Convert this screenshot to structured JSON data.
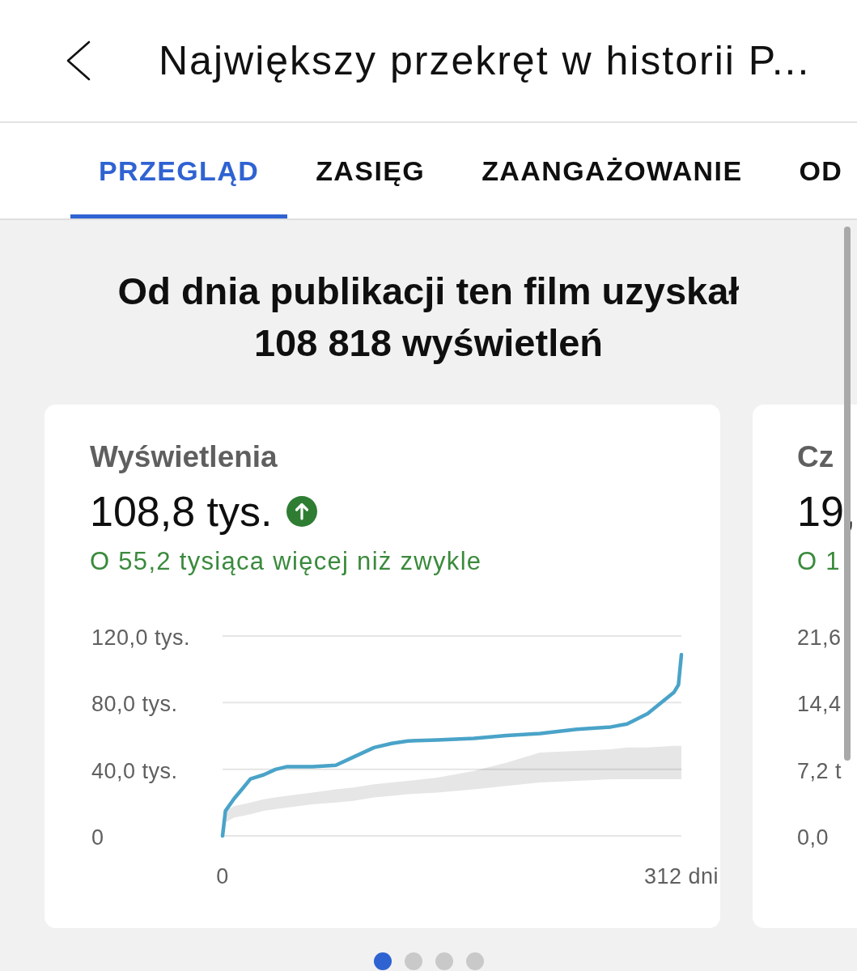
{
  "header": {
    "title": "Największy przekręt w historii P..."
  },
  "tabs": [
    {
      "label": "PRZEGLĄD",
      "selected": true
    },
    {
      "label": "ZASIĘG",
      "selected": false
    },
    {
      "label": "ZAANGAŻOWANIE",
      "selected": false
    },
    {
      "label": "OD",
      "selected": false
    }
  ],
  "headline": "Od dnia publikacji ten film uzyskał 108 818 wyświetleń",
  "cards": [
    {
      "title": "Wyświetlenia",
      "value": "108,8 tys.",
      "trend_up": true,
      "comparison": "O 55,2 tysiąca więcej niż zwykle",
      "typical_range": true,
      "chart_data": {
        "type": "line",
        "x": [
          0,
          2,
          8,
          14,
          19,
          28,
          36,
          44,
          61,
          77,
          89,
          103,
          115,
          126,
          146,
          171,
          193,
          216,
          241,
          264,
          275,
          289,
          307,
          310,
          312
        ],
        "series": [
          {
            "color": "#4aa3c8",
            "values": [
              0,
              15,
              22.5,
              28.8,
              34.2,
              36.7,
              39.9,
              41.6,
              41.6,
              42.4,
              47.3,
              53,
              55.5,
              57,
              57.5,
              58.5,
              60.2,
              61.5,
              64,
              65.4,
              67.2,
              73.4,
              86.3,
              90.7,
              108.8
            ]
          }
        ],
        "xlim": [
          0,
          312
        ],
        "ylim": [
          0,
          120
        ],
        "xticks": [
          {
            "value": 0,
            "label": "0"
          },
          {
            "value": 312,
            "label": "312 dni"
          }
        ],
        "yticks": [
          {
            "value": 120,
            "label": "120,0 tys."
          },
          {
            "value": 80,
            "label": "80,0 tys."
          },
          {
            "value": 40,
            "label": "40,0 tys."
          },
          {
            "value": 0,
            "label": "0"
          }
        ]
      }
    },
    {
      "title": "Cz",
      "value": "19,",
      "comparison": "O 1",
      "axis_labels": [
        "21,6",
        "14,4",
        "7,2 t",
        "0,0"
      ]
    }
  ],
  "pager": [
    {
      "selected": true
    },
    {
      "selected": false
    },
    {
      "selected": false
    },
    {
      "selected": false
    }
  ]
}
